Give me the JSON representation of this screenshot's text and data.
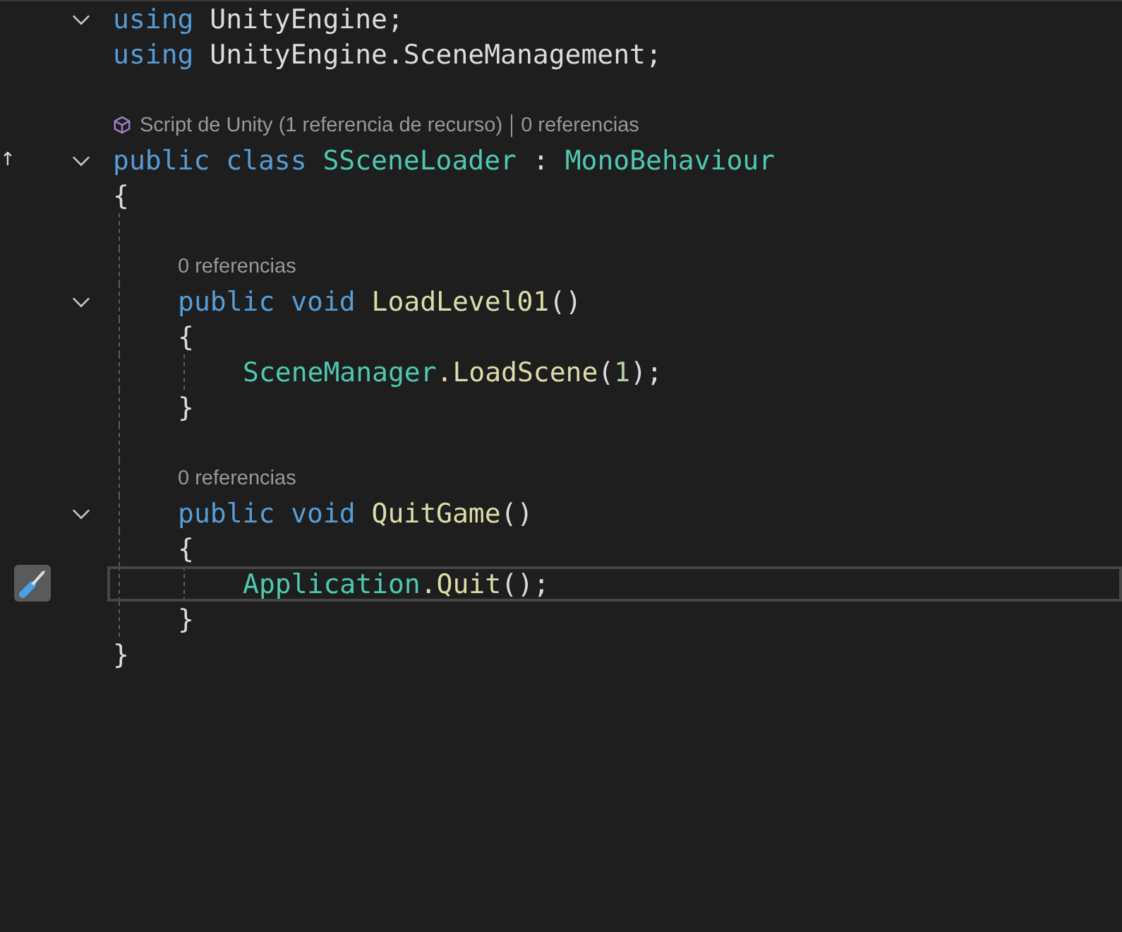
{
  "lines": [
    {
      "kind": "code",
      "fold": true,
      "tokens": [
        {
          "text": "using",
          "kind": "keyword"
        },
        {
          "text": " UnityEngine;",
          "kind": "plain"
        }
      ]
    },
    {
      "kind": "code",
      "tokens": [
        {
          "text": "using",
          "kind": "keyword"
        },
        {
          "text": " UnityEngine.SceneManagement;",
          "kind": "plain"
        }
      ]
    },
    {
      "kind": "blank"
    },
    {
      "kind": "lens",
      "parts": [
        {
          "text": "Script de Unity (1 referencia de recurso)",
          "kind": "asset"
        },
        {
          "text": "0 referencias"
        }
      ]
    },
    {
      "kind": "code",
      "fold": true,
      "marker": "↑",
      "tokens": [
        {
          "text": "public class",
          "kind": "keyword"
        },
        {
          "text": " SSceneLoader",
          "kind": "type"
        },
        {
          "text": " : ",
          "kind": "plain"
        },
        {
          "text": "MonoBehaviour",
          "kind": "type"
        }
      ]
    },
    {
      "kind": "code",
      "tokens": [
        {
          "text": "{",
          "kind": "plain"
        }
      ]
    },
    {
      "kind": "block",
      "children": [
        {
          "kind": "blank"
        },
        {
          "kind": "lens",
          "parts": [
            {
              "text": "0 referencias"
            }
          ]
        },
        {
          "kind": "code",
          "fold": true,
          "tokens": [
            {
              "text": "public void",
              "kind": "keyword"
            },
            {
              "text": " LoadLevel01",
              "kind": "method"
            },
            {
              "text": "()",
              "kind": "plain"
            }
          ]
        },
        {
          "kind": "code",
          "tokens": [
            {
              "text": "{",
              "kind": "plain"
            }
          ]
        },
        {
          "kind": "block",
          "children": [
            {
              "kind": "code",
              "tokens": [
                {
                  "text": "SceneManager",
                  "kind": "type"
                },
                {
                  "text": ".LoadScene",
                  "kind": "method"
                },
                {
                  "text": "(",
                  "kind": "plain"
                },
                {
                  "text": "1",
                  "kind": "number"
                },
                {
                  "text": ");",
                  "kind": "plain"
                }
              ]
            }
          ]
        },
        {
          "kind": "code",
          "tokens": [
            {
              "text": "}",
              "kind": "plain"
            }
          ]
        },
        {
          "kind": "blank"
        },
        {
          "kind": "lens",
          "parts": [
            {
              "text": "0 referencias"
            }
          ]
        },
        {
          "kind": "code",
          "fold": true,
          "tokens": [
            {
              "text": "public void",
              "kind": "keyword"
            },
            {
              "text": " QuitGame",
              "kind": "method"
            },
            {
              "text": "()",
              "kind": "plain"
            }
          ]
        },
        {
          "kind": "code",
          "tokens": [
            {
              "text": "{",
              "kind": "plain"
            }
          ]
        },
        {
          "kind": "block",
          "children": [
            {
              "kind": "code",
              "current": true,
              "quick_action": true,
              "tokens": [
                {
                  "text": "Application",
                  "kind": "type"
                },
                {
                  "text": ".Quit",
                  "kind": "method"
                },
                {
                  "text": "();",
                  "kind": "plain"
                }
              ]
            }
          ]
        },
        {
          "kind": "code",
          "tokens": [
            {
              "text": "}",
              "kind": "plain"
            }
          ]
        }
      ]
    },
    {
      "kind": "code",
      "tokens": [
        {
          "text": "}",
          "kind": "plain"
        }
      ]
    }
  ]
}
